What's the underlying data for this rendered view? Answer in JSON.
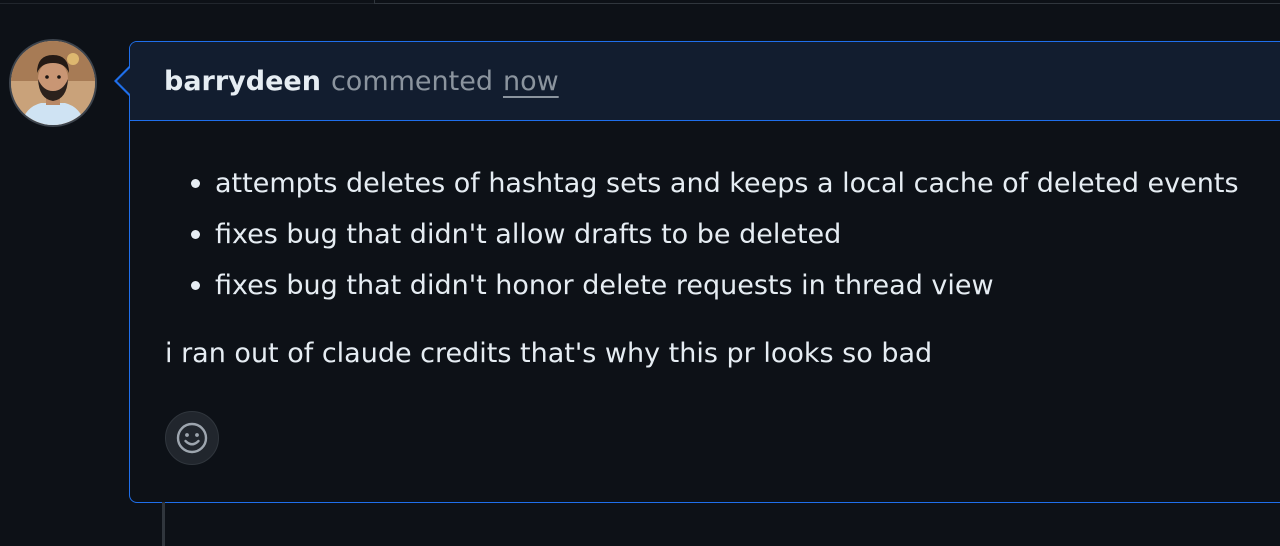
{
  "comment": {
    "author": "barrydeen",
    "action": "commented",
    "timestamp": "now",
    "bullets": [
      "attempts deletes of hashtag sets and keeps a local cache of deleted events",
      "fixes bug that didn't allow drafts to be deleted",
      "fixes bug that didn't honor delete requests in thread view"
    ],
    "paragraph": "i ran out of claude credits that's why this pr looks so bad"
  },
  "icons": {
    "avatar": "user-avatar",
    "reaction": "smiley-icon"
  },
  "colors": {
    "background": "#0d1117",
    "header_bg": "#121d2f",
    "accent_border": "#1f6feb",
    "muted_text": "#8b949e",
    "text": "#e6edf3"
  }
}
